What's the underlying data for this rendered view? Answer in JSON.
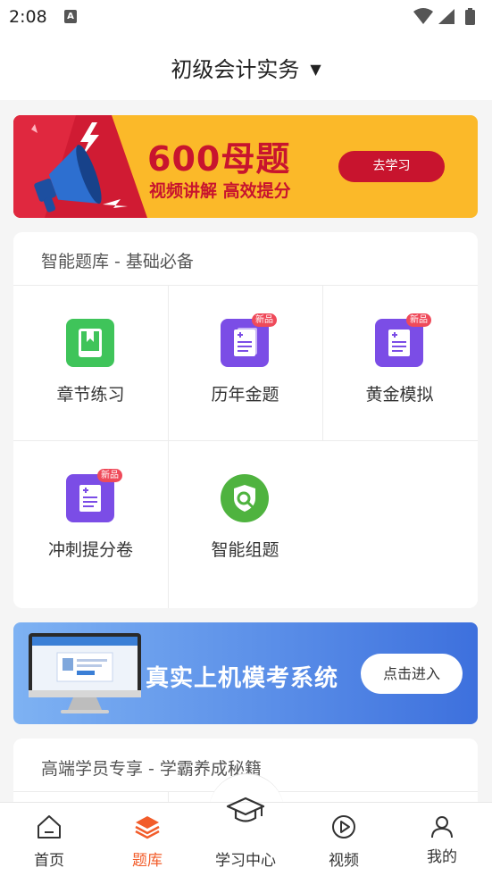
{
  "status_bar": {
    "time": "2:08",
    "notification_icon_letter": "A"
  },
  "header": {
    "title": "初级会计实务",
    "caret_icon": "caret-down-icon"
  },
  "promo_banner": {
    "title": "600母题",
    "subtitle": "视频讲解  高效提分",
    "button_label": "去学习",
    "colors": {
      "background": "#fbb929",
      "accent": "#c8142e"
    }
  },
  "question_bank": {
    "title": "智能题库 - 基础必备",
    "items": [
      {
        "label": "章节练习",
        "icon": "book-icon",
        "badge": ""
      },
      {
        "label": "历年金题",
        "icon": "document-icon",
        "badge": "新品"
      },
      {
        "label": "黄金模拟",
        "icon": "document-icon",
        "badge": "新品"
      },
      {
        "label": "冲刺提分卷",
        "icon": "document-icon",
        "badge": "新品"
      },
      {
        "label": "智能组题",
        "icon": "shield-search-icon",
        "badge": ""
      }
    ]
  },
  "exam_banner": {
    "title": "真实上机模考系统",
    "button_label": "点击进入"
  },
  "premium_section": {
    "title": "高端学员专享 - 学霸养成秘籍"
  },
  "tabbar": {
    "tabs": [
      {
        "label": "首页",
        "icon": "home-icon",
        "active": false
      },
      {
        "label": "题库",
        "icon": "layers-icon",
        "active": true
      },
      {
        "label": "学习中心",
        "icon": "graduation-cap-icon",
        "active": false
      },
      {
        "label": "视频",
        "icon": "play-circle-icon",
        "active": false
      },
      {
        "label": "我的",
        "icon": "user-icon",
        "active": false
      }
    ],
    "active_color": "#f25c2a"
  }
}
